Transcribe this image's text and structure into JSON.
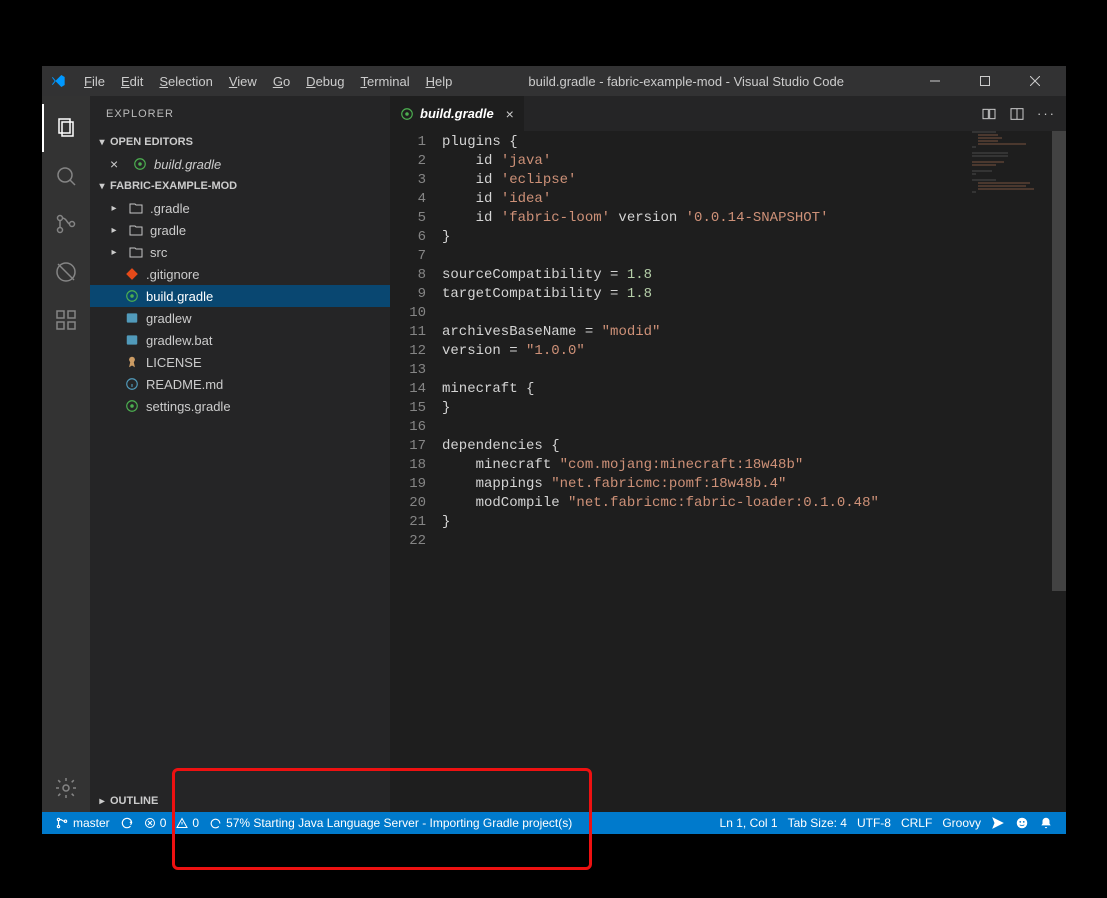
{
  "title": "build.gradle - fabric-example-mod - Visual Studio Code",
  "menu": [
    "File",
    "Edit",
    "Selection",
    "View",
    "Go",
    "Debug",
    "Terminal",
    "Help"
  ],
  "explorer": {
    "title": "EXPLORER",
    "open_editors": "OPEN EDITORS",
    "open_file": "build.gradle",
    "project": "FABRIC-EXAMPLE-MOD",
    "items": [
      {
        "label": ".gradle",
        "type": "folder"
      },
      {
        "label": "gradle",
        "type": "folder"
      },
      {
        "label": "src",
        "type": "folder"
      },
      {
        "label": ".gitignore",
        "type": "git"
      },
      {
        "label": "build.gradle",
        "type": "gradle",
        "selected": true
      },
      {
        "label": "gradlew",
        "type": "shell"
      },
      {
        "label": "gradlew.bat",
        "type": "bat"
      },
      {
        "label": "LICENSE",
        "type": "license"
      },
      {
        "label": "README.md",
        "type": "info"
      },
      {
        "label": "settings.gradle",
        "type": "gradle"
      }
    ],
    "outline": "OUTLINE"
  },
  "tab": {
    "label": "build.gradle"
  },
  "code": {
    "lines": [
      {
        "n": 1,
        "seg": [
          {
            "t": "plugins {",
            "c": ""
          }
        ]
      },
      {
        "n": 2,
        "seg": [
          {
            "t": "    id ",
            "c": ""
          },
          {
            "t": "'java'",
            "c": "t-str"
          }
        ]
      },
      {
        "n": 3,
        "seg": [
          {
            "t": "    id ",
            "c": ""
          },
          {
            "t": "'eclipse'",
            "c": "t-str"
          }
        ]
      },
      {
        "n": 4,
        "seg": [
          {
            "t": "    id ",
            "c": ""
          },
          {
            "t": "'idea'",
            "c": "t-str"
          }
        ]
      },
      {
        "n": 5,
        "seg": [
          {
            "t": "    id ",
            "c": ""
          },
          {
            "t": "'fabric-loom'",
            "c": "t-str"
          },
          {
            "t": " version ",
            "c": ""
          },
          {
            "t": "'0.0.14-SNAPSHOT'",
            "c": "t-str"
          }
        ]
      },
      {
        "n": 6,
        "seg": [
          {
            "t": "}",
            "c": ""
          }
        ]
      },
      {
        "n": 7,
        "seg": [
          {
            "t": "",
            "c": ""
          }
        ]
      },
      {
        "n": 8,
        "seg": [
          {
            "t": "sourceCompatibility = ",
            "c": ""
          },
          {
            "t": "1.8",
            "c": "t-num"
          }
        ]
      },
      {
        "n": 9,
        "seg": [
          {
            "t": "targetCompatibility = ",
            "c": ""
          },
          {
            "t": "1.8",
            "c": "t-num"
          }
        ]
      },
      {
        "n": 10,
        "seg": [
          {
            "t": "",
            "c": ""
          }
        ]
      },
      {
        "n": 11,
        "seg": [
          {
            "t": "archivesBaseName = ",
            "c": ""
          },
          {
            "t": "\"modid\"",
            "c": "t-str"
          }
        ]
      },
      {
        "n": 12,
        "seg": [
          {
            "t": "version = ",
            "c": ""
          },
          {
            "t": "\"1.0.0\"",
            "c": "t-str"
          }
        ]
      },
      {
        "n": 13,
        "seg": [
          {
            "t": "",
            "c": ""
          }
        ]
      },
      {
        "n": 14,
        "seg": [
          {
            "t": "minecraft {",
            "c": ""
          }
        ]
      },
      {
        "n": 15,
        "seg": [
          {
            "t": "}",
            "c": ""
          }
        ]
      },
      {
        "n": 16,
        "seg": [
          {
            "t": "",
            "c": ""
          }
        ]
      },
      {
        "n": 17,
        "seg": [
          {
            "t": "dependencies {",
            "c": ""
          }
        ]
      },
      {
        "n": 18,
        "seg": [
          {
            "t": "    minecraft ",
            "c": ""
          },
          {
            "t": "\"com.mojang:minecraft:18w48b\"",
            "c": "t-str"
          }
        ]
      },
      {
        "n": 19,
        "seg": [
          {
            "t": "    mappings ",
            "c": ""
          },
          {
            "t": "\"net.fabricmc:pomf:18w48b.4\"",
            "c": "t-str"
          }
        ]
      },
      {
        "n": 20,
        "seg": [
          {
            "t": "    modCompile ",
            "c": ""
          },
          {
            "t": "\"net.fabricmc:fabric-loader:0.1.0.48\"",
            "c": "t-str"
          }
        ]
      },
      {
        "n": 21,
        "seg": [
          {
            "t": "}",
            "c": ""
          }
        ]
      },
      {
        "n": 22,
        "seg": [
          {
            "t": "",
            "c": ""
          }
        ]
      }
    ]
  },
  "status": {
    "branch": "master",
    "errors": "0",
    "warnings": "0",
    "progress": "57% Starting Java Language Server - Importing Gradle project(s)",
    "position": "Ln 1, Col 1",
    "tabsize": "Tab Size: 4",
    "encoding": "UTF-8",
    "eol": "CRLF",
    "language": "Groovy"
  }
}
